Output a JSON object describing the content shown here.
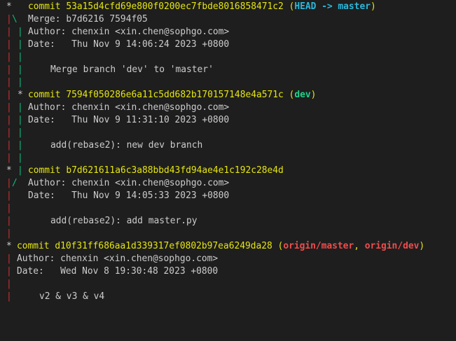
{
  "commits": [
    {
      "commit_word": "commit",
      "hash": "53a15d4cfd69e800f0200ec7fbde8016858471c2",
      "refs_open": "(",
      "head_ref": "HEAD -> master",
      "refs_close": ")",
      "merge_line": "Merge: b7d6216 7594f05",
      "author_line": "Author: chenxin <xin.chen@sophgo.com>",
      "date_line": "Date:   Thu Nov 9 14:06:24 2023 +0800",
      "message": "Merge branch 'dev' to 'master'"
    },
    {
      "commit_word": "commit",
      "hash": "7594f050286e6a11c5dd682b170157148e4a571c",
      "refs_open": "(",
      "branch_ref": "dev",
      "refs_close": ")",
      "author_line": "Author: chenxin <xin.chen@sophgo.com>",
      "date_line": "Date:   Thu Nov 9 11:31:10 2023 +0800",
      "message": "add(rebase2): new dev branch"
    },
    {
      "commit_word": "commit",
      "hash": "b7d621611a6c3a88bbd43fd94ae4e1c192c28e4d",
      "author_line": "Author: chenxin <xin.chen@sophgo.com>",
      "date_line": "Date:   Thu Nov 9 14:05:33 2023 +0800",
      "message": "add(rebase2): add master.py"
    },
    {
      "commit_word": "commit",
      "hash": "d10f31ff686aa1d339317ef0802b97ea6249da28",
      "refs_open": "(",
      "remote_ref_1": "origin/master",
      "refs_sep": ", ",
      "remote_ref_2": "origin/dev",
      "refs_close": ")",
      "author_line": "Author: chenxin <xin.chen@sophgo.com>",
      "date_line": "Date:   Wed Nov 8 19:30:48 2023 +0800",
      "message": "v2 & v3 & v4"
    }
  ],
  "graph": {
    "star": "*",
    "pipe": "|",
    "backslash": "\\",
    "slash": "/"
  },
  "colors": {
    "background": "#1e1e1e",
    "hash": "#e5e510",
    "head": "#29b8db",
    "local_branch": "#23d18b",
    "remote_branch": "#f14c4c",
    "graph_red": "#cd3131",
    "graph_green": "#0dbc79"
  }
}
